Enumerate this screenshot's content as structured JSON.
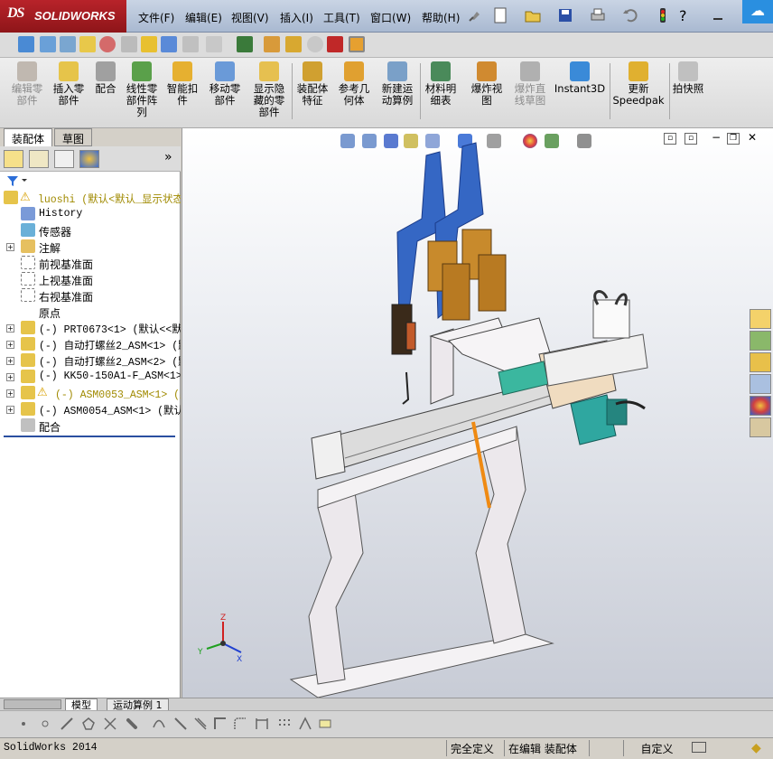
{
  "titlebar": {
    "logo_ds": "DS",
    "logo_text": "SOLIDWORKS",
    "menus": [
      "文件(F)",
      "编辑(E)",
      "视图(V)",
      "插入(I)",
      "工具(T)",
      "窗口(W)",
      "帮助(H)"
    ],
    "cloud_icon": "cloud-icon"
  },
  "commands": [
    {
      "label": "编辑零\n部件",
      "disabled": true
    },
    {
      "label": "插入零\n部件",
      "disabled": false
    },
    {
      "label": "配合",
      "disabled": false
    },
    {
      "label": "线性零\n部件阵\n列",
      "disabled": false
    },
    {
      "label": "智能扣\n件",
      "disabled": false
    },
    {
      "label": "移动零\n部件",
      "disabled": false
    },
    {
      "label": "显示隐\n藏的零\n部件",
      "disabled": false
    },
    {
      "label": "装配体\n特征",
      "disabled": false
    },
    {
      "label": "参考几\n何体",
      "disabled": false
    },
    {
      "label": "新建运\n动算例",
      "disabled": false
    },
    {
      "label": "材料明\n细表",
      "disabled": false
    },
    {
      "label": "爆炸视\n图",
      "disabled": false
    },
    {
      "label": "爆炸直\n线草图",
      "disabled": true
    },
    {
      "label": "Instant3D",
      "disabled": false
    },
    {
      "label": "更新\nSpeedpak",
      "disabled": false
    },
    {
      "label": "拍快照",
      "disabled": false
    }
  ],
  "left_tabs": {
    "assembly": "装配体",
    "sketch": "草图"
  },
  "tree": [
    {
      "label": "luoshi  (默认<默认_显示状态",
      "icon": "assembly-warning-icon",
      "mono": true,
      "warn": true,
      "expand": false,
      "indent": 0
    },
    {
      "label": "History",
      "icon": "history-icon",
      "mono": true,
      "warn": false,
      "expand": false,
      "indent": 1
    },
    {
      "label": "传感器",
      "icon": "sensor-icon",
      "mono": false,
      "warn": false,
      "expand": false,
      "indent": 1
    },
    {
      "label": "注解",
      "icon": "annotation-icon",
      "mono": false,
      "warn": false,
      "expand": true,
      "indent": 1
    },
    {
      "label": "前视基准面",
      "icon": "plane-icon",
      "mono": false,
      "warn": false,
      "expand": false,
      "indent": 1
    },
    {
      "label": "上视基准面",
      "icon": "plane-icon",
      "mono": false,
      "warn": false,
      "expand": false,
      "indent": 1
    },
    {
      "label": "右视基准面",
      "icon": "plane-icon",
      "mono": false,
      "warn": false,
      "expand": false,
      "indent": 1
    },
    {
      "label": "原点",
      "icon": "origin-icon",
      "mono": false,
      "warn": false,
      "expand": false,
      "indent": 1
    },
    {
      "label": "(-) PRT0673<1> (默认<<默认",
      "icon": "part-icon",
      "mono": true,
      "warn": false,
      "expand": true,
      "indent": 1
    },
    {
      "label": "(-) 自动打螺丝2_ASM<1> (默",
      "icon": "subassembly-icon",
      "mono": true,
      "warn": false,
      "expand": true,
      "indent": 1
    },
    {
      "label": "(-) 自动打螺丝2_ASM<2> (默",
      "icon": "subassembly-icon",
      "mono": true,
      "warn": false,
      "expand": true,
      "indent": 1
    },
    {
      "label": "(-) KK50-150A1-F_ASM<1> (",
      "icon": "subassembly-icon",
      "mono": true,
      "warn": false,
      "expand": true,
      "indent": 1
    },
    {
      "label": "(-) ASM0053_ASM<1> (默认",
      "icon": "subassembly-warning-icon",
      "mono": true,
      "warn": true,
      "expand": true,
      "indent": 1
    },
    {
      "label": "(-) ASM0054_ASM<1> (默认<",
      "icon": "subassembly-icon",
      "mono": true,
      "warn": false,
      "expand": true,
      "indent": 1
    },
    {
      "label": "配合",
      "icon": "mates-icon",
      "mono": false,
      "warn": false,
      "expand": false,
      "indent": 1
    }
  ],
  "bottom_tabs": {
    "model": "模型",
    "motion": "运动算例 1"
  },
  "status": {
    "app": "SolidWorks 2014",
    "defined": "完全定义",
    "editing": "在编辑 装配体",
    "units": "自定义"
  },
  "axis_labels": {
    "x": "X",
    "y": "Y",
    "z": "Z"
  },
  "colors": {
    "accent": "#b8232a",
    "cloud": "#2a8fe0",
    "frame": "#ece8ec",
    "motor": "#2fa7a0",
    "gun": "#3567c4",
    "cylinder": "#c88a2c"
  }
}
